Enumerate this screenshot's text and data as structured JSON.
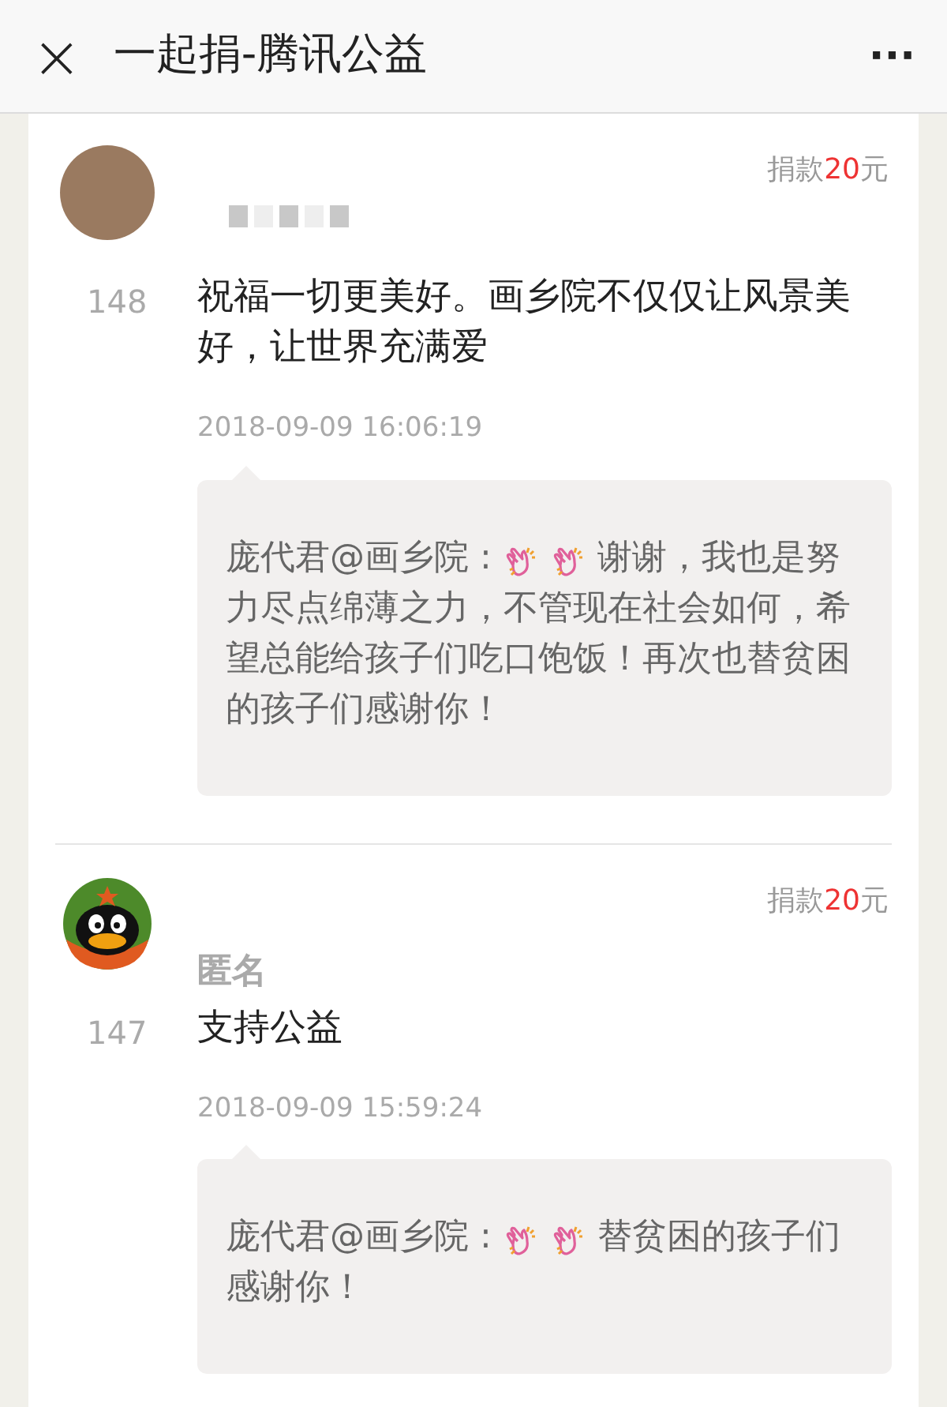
{
  "header": {
    "close": "×",
    "title": "一起捐-腾讯公益",
    "more": "···"
  },
  "donations": [
    {
      "avatar": {
        "kind": "photo"
      },
      "rank": "148",
      "amount_label": "捐款",
      "amount": "20",
      "amount_unit": "元",
      "message": "祝福一切更美好。画乡院不仅仅让风景美好，让世界充满爱",
      "time": "2018-09-09 16:06:19",
      "reply": {
        "author": "庞代君@画乡院 : ",
        "text": "谢谢，我也是努力尽点绵薄之力，不管现在社会如何，希望总能给孩子们吃口饱饭！再次也替贫困的孩子们感谢你！"
      }
    },
    {
      "avatar": {
        "kind": "penguin"
      },
      "name": "匿名",
      "rank": "147",
      "amount_label": "捐款",
      "amount": "20",
      "amount_unit": "元",
      "message": "支持公益",
      "time": "2018-09-09 15:59:24",
      "reply": {
        "author": "庞代君@画乡院 : ",
        "text": "替贫困的孩子们感谢你！"
      }
    }
  ]
}
